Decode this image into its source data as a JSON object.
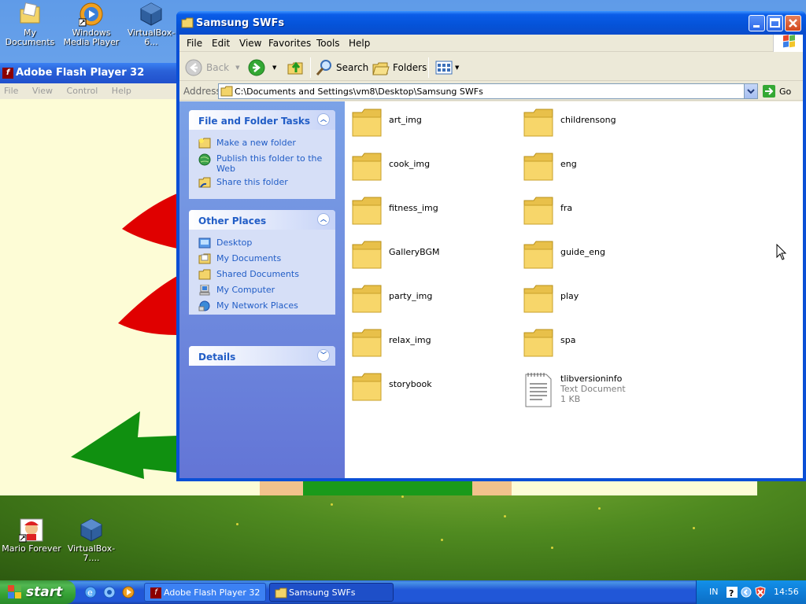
{
  "desktop": {
    "icons": [
      {
        "label": "My Documents",
        "name": "my-documents"
      },
      {
        "label": "Windows Media Player",
        "name": "windows-media-player"
      },
      {
        "label": "VirtualBox-6...",
        "name": "virtualbox-6"
      },
      {
        "label": "Mario Forever",
        "name": "mario-forever"
      },
      {
        "label": "VirtualBox-7....",
        "name": "virtualbox-7"
      }
    ]
  },
  "flash": {
    "title": "Adobe Flash Player 32",
    "menu": [
      "File",
      "View",
      "Control",
      "Help"
    ]
  },
  "explorer": {
    "title": "Samsung SWFs",
    "menu": [
      "File",
      "Edit",
      "View",
      "Favorites",
      "Tools",
      "Help"
    ],
    "toolbar": {
      "back": "Back",
      "search": "Search",
      "folders": "Folders"
    },
    "address": {
      "label": "Address",
      "path": "C:\\Documents and Settings\\vm8\\Desktop\\Samsung SWFs",
      "go": "Go"
    },
    "tasks": {
      "file_folder": {
        "title": "File and Folder Tasks",
        "items": [
          "Make a new folder",
          "Publish this folder to the Web",
          "Share this folder"
        ]
      },
      "other_places": {
        "title": "Other Places",
        "items": [
          "Desktop",
          "My Documents",
          "Shared Documents",
          "My Computer",
          "My Network Places"
        ]
      },
      "details": {
        "title": "Details"
      }
    },
    "files_left": [
      "art_img",
      "cook_img",
      "fitness_img",
      "GalleryBGM",
      "party_img",
      "relax_img",
      "storybook"
    ],
    "files_right": [
      "childrensong",
      "eng",
      "fra",
      "guide_eng",
      "play",
      "spa"
    ],
    "text_file": {
      "name": "tlibversioninfo",
      "type": "Text Document",
      "size": "1 KB"
    }
  },
  "taskbar": {
    "start": "start",
    "tasks": [
      "Adobe Flash Player 32",
      "Samsung SWFs"
    ],
    "tray": {
      "lang": "IN",
      "time": "14:56"
    }
  }
}
